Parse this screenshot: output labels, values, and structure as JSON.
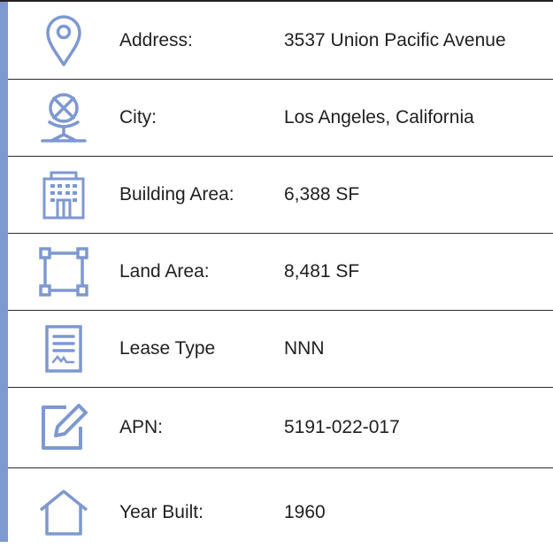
{
  "accent_color": "#7e98d0",
  "rows": [
    {
      "icon": "location-pin-icon",
      "label": "Address:",
      "value": "3537 Union Pacific Avenue"
    },
    {
      "icon": "globe-stand-icon",
      "label": "City:",
      "value": "Los Angeles, California"
    },
    {
      "icon": "building-icon",
      "label": "Building Area:",
      "value": "6,388 SF"
    },
    {
      "icon": "land-area-frame-icon",
      "label": "Land Area:",
      "value": "8,481 SF"
    },
    {
      "icon": "lease-document-icon",
      "label": "Lease Type",
      "value": "NNN"
    },
    {
      "icon": "edit-pencil-icon",
      "label": "APN:",
      "value": "5191-022-017"
    },
    {
      "icon": "house-icon",
      "label": "Year Built:",
      "value": "1960"
    }
  ]
}
